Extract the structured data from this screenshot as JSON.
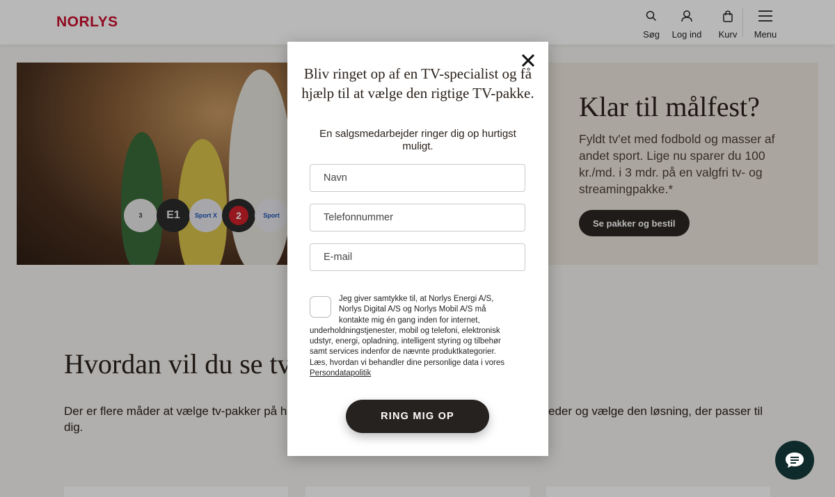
{
  "header": {
    "logo": "NORLYS",
    "nav": {
      "search": "Søg",
      "login": "Log ind",
      "cart": "Kurv",
      "menu": "Menu"
    }
  },
  "hero": {
    "title": "Klar til målfest?",
    "text": "Fyldt tv'et med fodbold og masser af andet sport. Lige nu sparer du 100 kr./md. i 3 mdr. på en valgfri tv- og streamingpakke.*",
    "button": "Se pakker og bestil",
    "channels": [
      "3",
      "E1",
      "Sport X",
      "2",
      "Sport"
    ]
  },
  "section": {
    "title": "Hvordan vil du se tv?",
    "text_left": "Der er flere måder at vælge tv-pakker på h",
    "text_left_2": "dig.",
    "text_right": "eder og vælge den løsning, der passer til"
  },
  "modal": {
    "title": "Bliv ringet op af en TV-specialist og få hjælp til at vælge den rigtige TV-pakke.",
    "subtitle": "En salgsmedarbejder ringer dig op hurtigst muligt.",
    "fields": {
      "name_placeholder": "Navn",
      "phone_placeholder": "Telefonnummer",
      "email_placeholder": "E-mail"
    },
    "consent_lines": [
      "Jeg giver samtykke til, at Norlys Energi A/S,",
      "Norlys Digital A/S og Norlys Mobil A/S må",
      "kontakte mig én gang inden for internet,",
      "underholdningstjenester, mobil og telefoni, elektronisk",
      "udstyr, energi, opladning, intelligent styring og tilbehør",
      "samt services indenfor de nævnte produktkategorier.",
      "Læs, hvordan vi behandler dine personlige data i vores"
    ],
    "consent_link": "Persondatapolitik",
    "submit": "RING MIG OP"
  },
  "colors": {
    "brand_red": "#c8102e",
    "dark_button": "#262220",
    "chat_bg": "#0f2a2a"
  }
}
